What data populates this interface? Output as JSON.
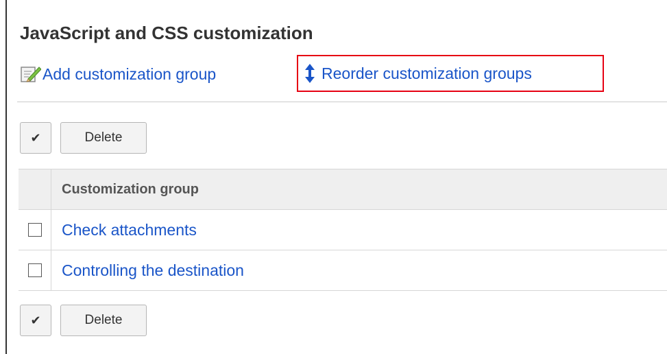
{
  "page": {
    "title": "JavaScript and CSS customization"
  },
  "toolbar": {
    "add_link": {
      "label": "Add customization group",
      "icon": "pencil-edit-icon"
    },
    "reorder_link": {
      "label": "Reorder customization groups",
      "icon": "up-down-arrow-icon",
      "highlighted": true,
      "highlight_color": "#e60012"
    }
  },
  "actions_top": {
    "check_all_label": "✔",
    "delete_label": "Delete"
  },
  "actions_bottom": {
    "check_all_label": "✔",
    "delete_label": "Delete"
  },
  "table": {
    "columns": [
      "",
      "Customization group"
    ],
    "rows": [
      {
        "checked": false,
        "name": "Check attachments"
      },
      {
        "checked": false,
        "name": "Controlling the destination"
      }
    ]
  },
  "colors": {
    "link": "#1a55c8",
    "header_bg": "#efefef",
    "highlight_border": "#e60012"
  }
}
